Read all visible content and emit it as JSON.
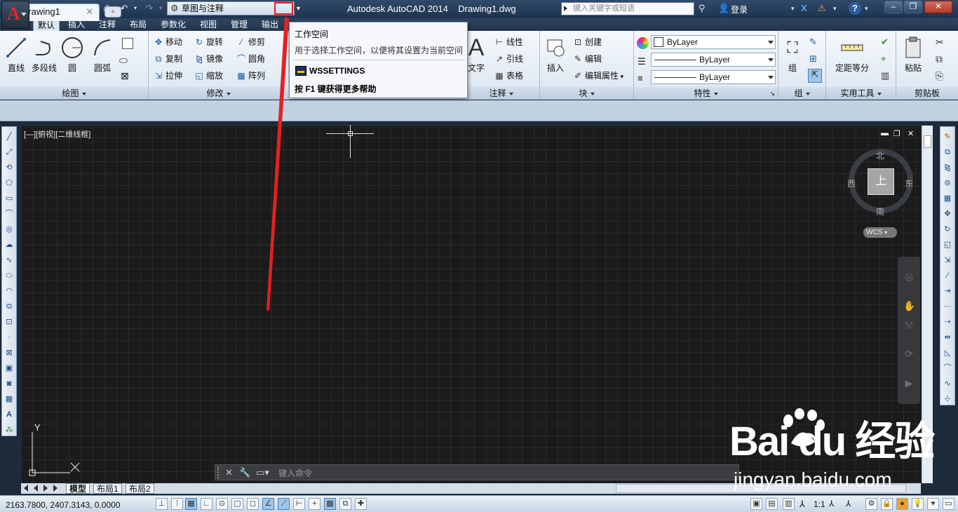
{
  "app": {
    "letter": "A",
    "title": "Autodesk AutoCAD 2014    Drawing1.dwg",
    "workspace": "草图与注释",
    "search_placeholder": "键入关键字或短语",
    "login": "登录"
  },
  "ribbon_tabs": [
    "默认",
    "插入",
    "注释",
    "布局",
    "参数化",
    "视图",
    "管理",
    "输出"
  ],
  "draw_panel": {
    "title": "绘图",
    "tools": [
      "直线",
      "多段线",
      "圆",
      "圆弧"
    ]
  },
  "modify_panel": {
    "title": "修改",
    "rows": [
      [
        "移动",
        "旋转",
        "修剪"
      ],
      [
        "复制",
        "镜像",
        "圆角"
      ],
      [
        "拉伸",
        "缩放",
        "阵列"
      ]
    ]
  },
  "annotation_panel": {
    "title": "注释",
    "big": "文字",
    "big_glyph": "A",
    "items": [
      "线性",
      "引线",
      "表格"
    ]
  },
  "block_panel": {
    "title": "块",
    "big": "插入",
    "items": [
      "创建",
      "编辑",
      "编辑属性"
    ]
  },
  "properties_panel": {
    "title": "特性",
    "values": [
      "ByLayer",
      "ByLayer",
      "ByLayer"
    ]
  },
  "group_panel": {
    "title": "组",
    "big": "组"
  },
  "utilities_panel": {
    "title": "实用工具",
    "big": "定距等分"
  },
  "clipboard_panel": {
    "title": "剪贴板",
    "big": "粘贴"
  },
  "tooltip": {
    "title": "工作空间",
    "description": "用于选择工作空间，以便将其设置为当前空间",
    "command": "WSSETTINGS",
    "help": "按 F1 键获得更多帮助"
  },
  "file_tab": {
    "name": "Drawing1"
  },
  "viewport": {
    "label": "[—][俯视][二维线框]",
    "cube_face": "上",
    "north": "北",
    "south": "南",
    "east": "东",
    "west": "西",
    "wcs": "WCS",
    "ucs_y": "Y"
  },
  "command_line": {
    "placeholder": "键入命令"
  },
  "layout_tabs": [
    "模型",
    "布局1",
    "布局2"
  ],
  "status": {
    "coords": "2163.7800, 2407.3143, 0.0000",
    "scale": "1:1"
  },
  "watermark": {
    "brand": "Bai du 经验",
    "url": "jingyan.baidu.com"
  },
  "colors": {
    "highlight": "#e52020",
    "canvas": "#1b1b1b",
    "ribbon": "#dbe5f0",
    "title_bar": "#1d3450"
  }
}
